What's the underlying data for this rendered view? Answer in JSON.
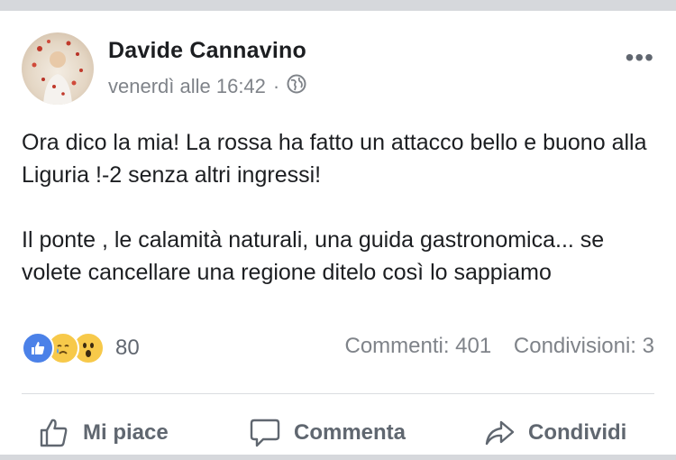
{
  "post": {
    "author": "Davide Cannavino",
    "timestamp": "venerdì alle 16:42",
    "separator": "·",
    "privacy_icon": "globe-icon",
    "more_label": "•••",
    "paragraphs": [
      "Ora dico la mia! La rossa ha fatto un attacco bello e buono alla Liguria !-2 senza altri ingressi!",
      "Il ponte , le calamità naturali, una guida gastronomica... se volete cancellare una regione ditelo così lo sappiamo"
    ]
  },
  "stats": {
    "reactions": [
      "like-icon",
      "sad-icon",
      "wow-icon"
    ],
    "reaction_count": "80",
    "comments": "Commenti: 401",
    "shares": "Condivisioni: 3"
  },
  "actions": {
    "like": "Mi piace",
    "comment": "Commenta",
    "share": "Condividi"
  },
  "colors": {
    "like_blue": "#4b81e8",
    "reaction_yellow": "#f7c94a",
    "text_secondary": "#7f8389"
  }
}
